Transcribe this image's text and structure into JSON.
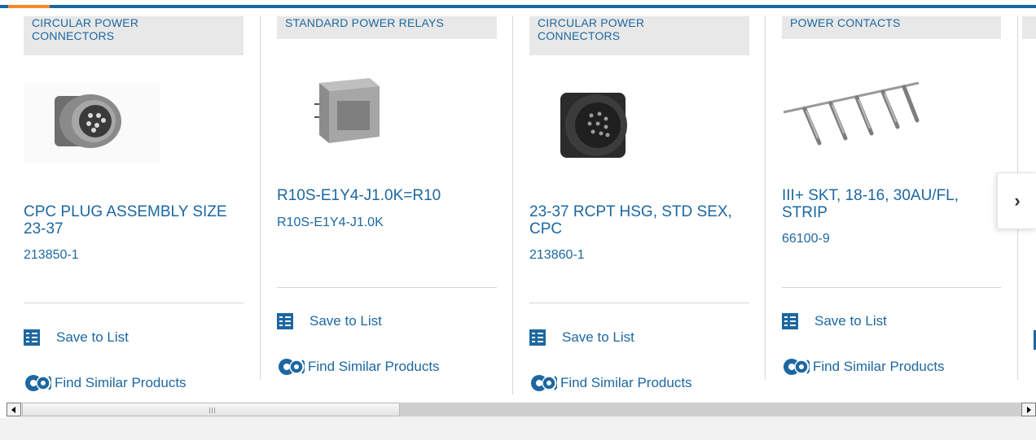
{
  "cards": [
    {
      "category": "CIRCULAR POWER CONNECTORS",
      "title": "CPC PLUG ASSEMBLY SIZE 23-37",
      "part_number": "213850-1",
      "save_label": "Save to List",
      "similar_label": "Find Similar Products",
      "image": "circular-plug-connector"
    },
    {
      "category": "STANDARD POWER RELAYS",
      "title": "R10S-E1Y4-J1.0K=R10",
      "part_number": "R10S-E1Y4-J1.0K",
      "save_label": "Save to List",
      "similar_label": "Find Similar Products",
      "image": "power-relay"
    },
    {
      "category": "CIRCULAR POWER CONNECTORS",
      "title": "23-37 RCPT HSG, STD SEX, CPC",
      "part_number": "213860-1",
      "save_label": "Save to List",
      "similar_label": "Find Similar Products",
      "image": "circular-receptacle-connector"
    },
    {
      "category": "POWER CONTACTS",
      "title": "III+ SKT, 18-16, 30AU/FL, STRIP",
      "part_number": "66100-9",
      "save_label": "Save to List",
      "similar_label": "Find Similar Products",
      "image": "contact-strip"
    }
  ],
  "carousel": {
    "next_icon": "chevron-right-icon",
    "next_label": "›"
  },
  "colors": {
    "brand_blue": "#1c67a1",
    "accent_orange": "#f28c28",
    "category_bg": "#e8e8e8"
  }
}
